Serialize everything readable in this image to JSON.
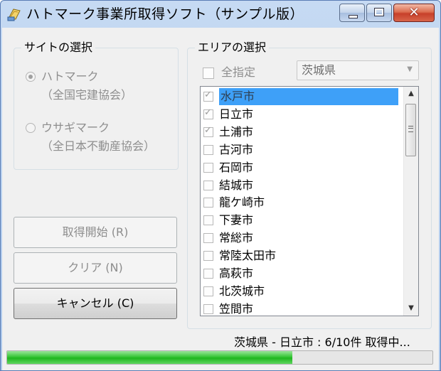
{
  "window": {
    "title": "ハトマーク事業所取得ソフト（サンプル版）",
    "close_symbol": "✕"
  },
  "site_group": {
    "legend": "サイトの選択",
    "options": [
      {
        "label": "ハトマーク",
        "sub": "（全国宅建協会）",
        "selected": true
      },
      {
        "label": "ウサギマーク",
        "sub": "（全日本不動産協会）",
        "selected": false
      }
    ]
  },
  "buttons": {
    "start": "取得開始 (R)",
    "clear": "クリア (N)",
    "cancel": "キャンセル (C)"
  },
  "area_group": {
    "legend": "エリアの選択",
    "select_all_label": "全指定",
    "select_all_checked": false,
    "prefecture": "茨城県",
    "cities": [
      {
        "name": "水戸市",
        "checked": true,
        "selected": true
      },
      {
        "name": "日立市",
        "checked": true,
        "selected": false
      },
      {
        "name": "土浦市",
        "checked": true,
        "selected": false
      },
      {
        "name": "古河市",
        "checked": false,
        "selected": false
      },
      {
        "name": "石岡市",
        "checked": false,
        "selected": false
      },
      {
        "name": "結城市",
        "checked": false,
        "selected": false
      },
      {
        "name": "龍ケ崎市",
        "checked": false,
        "selected": false
      },
      {
        "name": "下妻市",
        "checked": false,
        "selected": false
      },
      {
        "name": "常総市",
        "checked": false,
        "selected": false
      },
      {
        "name": "常陸太田市",
        "checked": false,
        "selected": false
      },
      {
        "name": "高萩市",
        "checked": false,
        "selected": false
      },
      {
        "name": "北茨城市",
        "checked": false,
        "selected": false
      },
      {
        "name": "笠間市",
        "checked": false,
        "selected": false
      }
    ]
  },
  "status": {
    "text": "茨城県 - 日立市 : 6/10件 取得中...",
    "progress_fraction": 0.67
  },
  "colors": {
    "progress_green": "#1fb51f",
    "selection_blue": "#3ea0f8",
    "close_red": "#c7402a"
  }
}
